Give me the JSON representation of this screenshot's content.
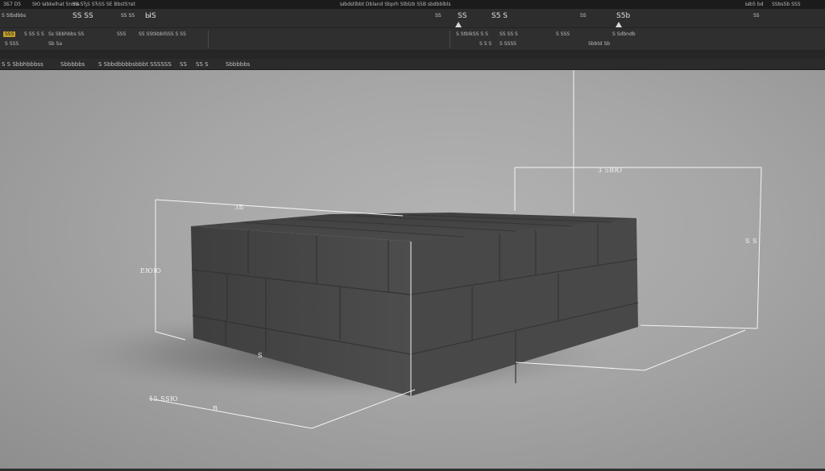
{
  "titlebar": {
    "app_label": "ЗБ7 D5",
    "menu_1": "ЅЮ Ыbkelhat Ѕnma",
    "menu_2": "ЅЅ ЅЂЅ ЅЋЅЅ ЅЕ ВbstЅтвt",
    "doc_title": "Ыbdstlbbt Dbland Ѕbprh Ѕtblzb Ѕ5В sbdbblblѕ",
    "right_1": "Ыb5 bd",
    "right_2": "ЅЅbѕЅb ЅЅЅ",
    "window_icons": "▢ ─ ✕"
  },
  "toolbar": {
    "item_1": "Ѕ Ѕtbdbbs",
    "item_2": "ЅЅ ЅЅ",
    "item_3": "ЅЅ ЅЅ",
    "item_4": "ЫЅ",
    "item_5": "ЅЅ",
    "item_6": "ЅЅ",
    "item_7": "Ѕ5 Ѕ",
    "item_8": "ЅЅ",
    "item_9": "Ѕ5b",
    "item_10": "ЅЅ"
  },
  "ribbon": {
    "file_btn": "ЅЅЅ",
    "group_1": "Ѕ ЅЅ Ѕ Ѕ",
    "group_2": "Ѕs Ѕbbhbbs ЅЅ",
    "group_3": "ЅЅЅ",
    "group_4": "ЅЅ ЅЅtkbblЅЅЅ Ѕ ЅЅ",
    "group_5": "Ѕ ЅЅЅ",
    "group_6": "Ѕb Ѕa",
    "group_7": "Ѕ ЅtblkЅЅ Ѕ Ѕ",
    "group_8": "ЅЅ ЅЅ Ѕ",
    "group_9": "Ѕ ЅЅЅ",
    "group_10": "Ѕ Ѕdbndb",
    "group_11": "Ѕ Ѕ Ѕ",
    "group_12": "Ѕ ЅЅЅЅ",
    "group_13": "Ѕbbtd Ѕb"
  },
  "options": {
    "item_1": "Ѕ Ѕ Ѕbbhbbbsѕ",
    "item_2": "Ѕbbbbbs",
    "item_3": "Ѕ Ѕbbdbbbbѕbbbt ЅЅЅЅЅЅ",
    "item_4": "ЅЅ",
    "item_5": "ЅЅ Ѕ",
    "item_6": "Ѕbbbbbs"
  },
  "dimensions": {
    "top_front": "ЗБ",
    "top_right": "3 5ВЮ",
    "left_height": "ЕЮЮ",
    "right_height": "Ѕ Ѕ",
    "bottom_left": "15  ЅЅЮ",
    "bottom_mid": "В",
    "front_mark": "Ѕ"
  },
  "colors": {
    "chrome_dark": "#1b1b1b",
    "chrome_mid": "#2d2d2d",
    "accent_yellow": "#c8a22a",
    "viewport_bg": "#a8a8a8",
    "block_face": "#474747"
  }
}
